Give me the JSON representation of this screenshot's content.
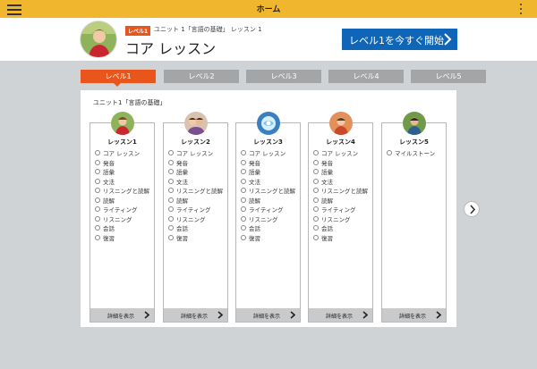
{
  "topbar": {
    "title": "ホーム",
    "menu_icon": "hamburger-icon",
    "more_icon": "vertical-dots-icon"
  },
  "header": {
    "level_badge": "レベル1",
    "breadcrumb": "ユニット 1「言語の基礎」 レッスン 1",
    "title": "コア レッスン",
    "start_button": "レベル1を今すぐ開始"
  },
  "tabs": [
    {
      "label": "レベル1",
      "active": true
    },
    {
      "label": "レベル2",
      "active": false
    },
    {
      "label": "レベル3",
      "active": false
    },
    {
      "label": "レベル4",
      "active": false
    },
    {
      "label": "レベル5",
      "active": false
    }
  ],
  "unit_title": "ユニット1「言語の基礎」",
  "lessons": [
    {
      "name": "レッスン1",
      "items": [
        "コア レッスン",
        "発音",
        "語彙",
        "文法",
        "リスニングと読解",
        "読解",
        "ライティング",
        "リスニング",
        "会話",
        "復習"
      ],
      "detail": "詳細を表示"
    },
    {
      "name": "レッスン2",
      "items": [
        "コア レッスン",
        "発音",
        "語彙",
        "文法",
        "リスニングと読解",
        "読解",
        "ライティング",
        "リスニング",
        "会話",
        "復習"
      ],
      "detail": "詳細を表示"
    },
    {
      "name": "レッスン3",
      "items": [
        "コア レッスン",
        "発音",
        "語彙",
        "文法",
        "リスニングと読解",
        "読解",
        "ライティング",
        "リスニング",
        "会話",
        "復習"
      ],
      "detail": "詳細を表示"
    },
    {
      "name": "レッスン4",
      "items": [
        "コア レッスン",
        "発音",
        "語彙",
        "文法",
        "リスニングと読解",
        "読解",
        "ライティング",
        "リスニング",
        "会話",
        "復習"
      ],
      "detail": "詳細を表示"
    },
    {
      "name": "レッスン5",
      "items": [
        "マイルストーン"
      ],
      "detail": "詳細を表示"
    }
  ],
  "colors": {
    "topbar": "#f0b72e",
    "accent": "#e9561b",
    "primary": "#0f66b8",
    "tab_inactive": "#a3a5a6"
  }
}
